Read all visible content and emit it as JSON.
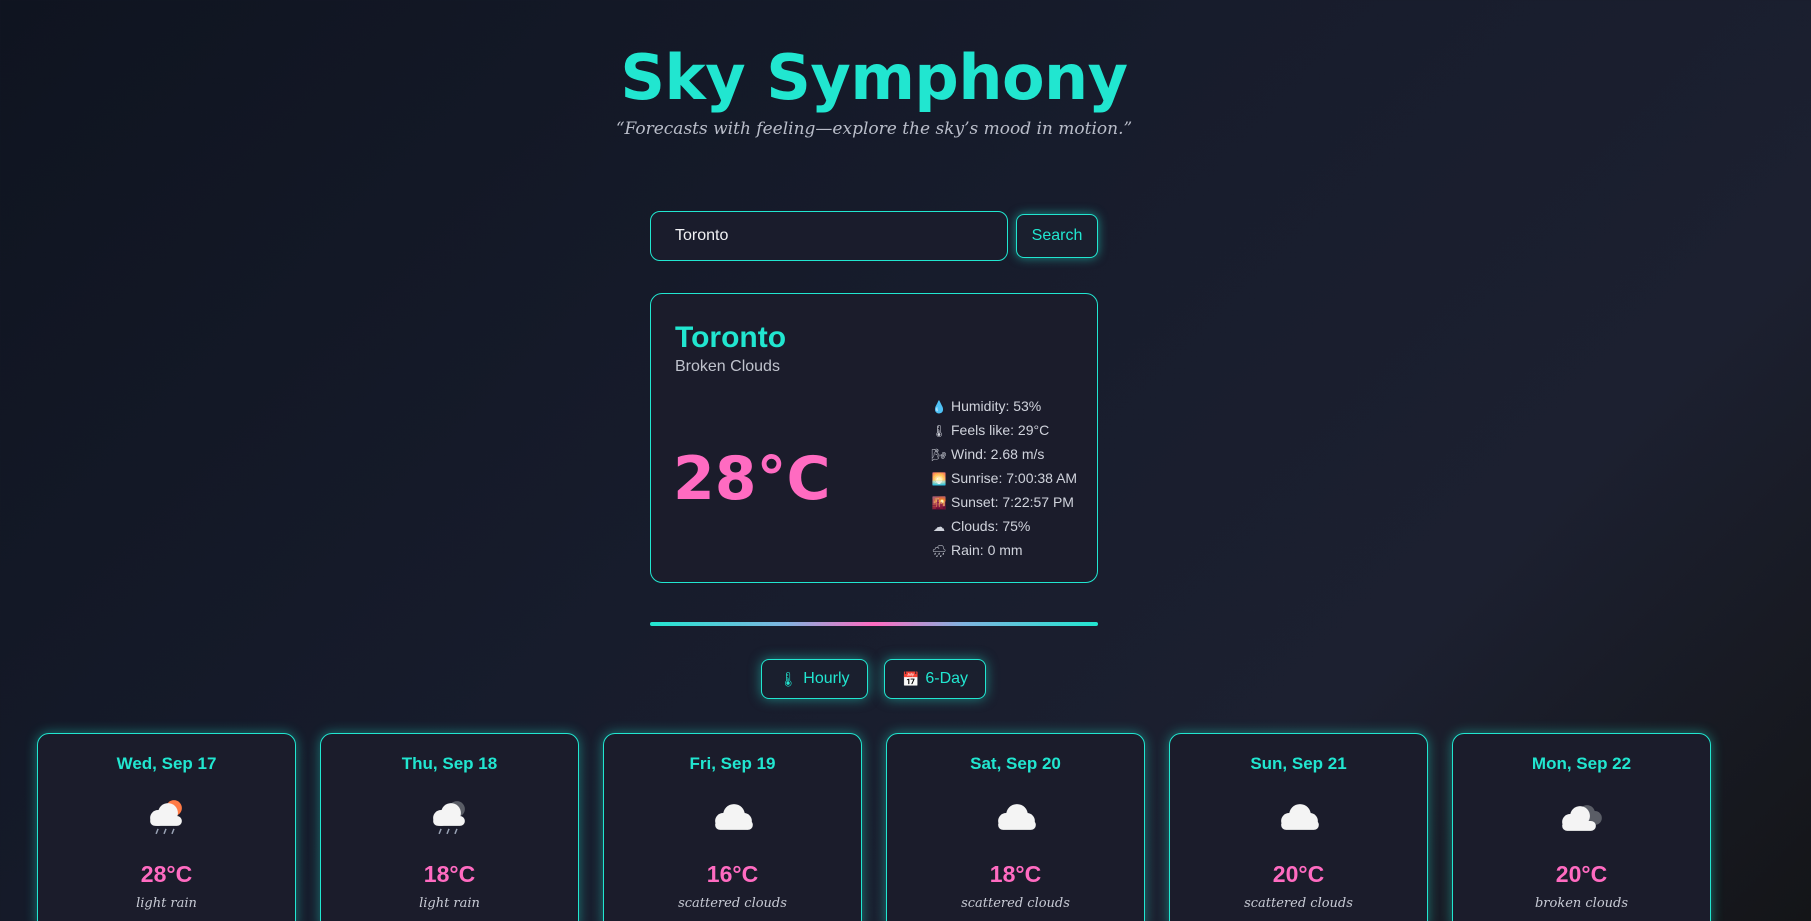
{
  "header": {
    "title": "Sky Symphony",
    "subtitle": "“Forecasts with feeling—explore the sky’s mood in motion.”"
  },
  "search": {
    "value": "Toronto",
    "button_label": "Search"
  },
  "current": {
    "city": "Toronto",
    "condition": "Broken Clouds",
    "temperature": "28°C",
    "details": [
      {
        "icon": "droplet-icon",
        "glyph": "💧",
        "text": "Humidity: 53%"
      },
      {
        "icon": "thermometer-icon",
        "glyph": "🌡",
        "text": "Feels like: 29°C"
      },
      {
        "icon": "wind-icon",
        "glyph": "🌬",
        "text": "Wind: 2.68 m/s"
      },
      {
        "icon": "sunrise-icon",
        "glyph": "🌅",
        "text": "Sunrise: 7:00:38 AM"
      },
      {
        "icon": "sunset-icon",
        "glyph": "🌇",
        "text": "Sunset: 7:22:57 PM"
      },
      {
        "icon": "cloud-icon",
        "glyph": "☁",
        "text": "Clouds: 75%"
      },
      {
        "icon": "rain-cloud-icon",
        "glyph": "🌧",
        "text": "Rain: 0 mm"
      }
    ]
  },
  "toggles": {
    "hourly_label": "Hourly",
    "hourly_icon": "thermometer-icon",
    "sixday_label": "6-Day",
    "sixday_icon": "calendar-icon"
  },
  "forecast": [
    {
      "day": "Wed, Sep 17",
      "icon": "rain-sun-icon",
      "temp": "28°C",
      "desc": "light rain"
    },
    {
      "day": "Thu, Sep 18",
      "icon": "rain-cloud-icon",
      "temp": "18°C",
      "desc": "light rain"
    },
    {
      "day": "Fri, Sep 19",
      "icon": "cloud-icon",
      "temp": "16°C",
      "desc": "scattered clouds"
    },
    {
      "day": "Sat, Sep 20",
      "icon": "cloud-icon",
      "temp": "18°C",
      "desc": "scattered clouds"
    },
    {
      "day": "Sun, Sep 21",
      "icon": "cloud-icon",
      "temp": "20°C",
      "desc": "scattered clouds"
    },
    {
      "day": "Mon, Sep 22",
      "icon": "broken-clouds-icon",
      "temp": "20°C",
      "desc": "broken clouds"
    }
  ],
  "colors": {
    "accent": "#21e6d0",
    "temperature": "#ff6bc1",
    "card_background": "#1b1c2b"
  }
}
